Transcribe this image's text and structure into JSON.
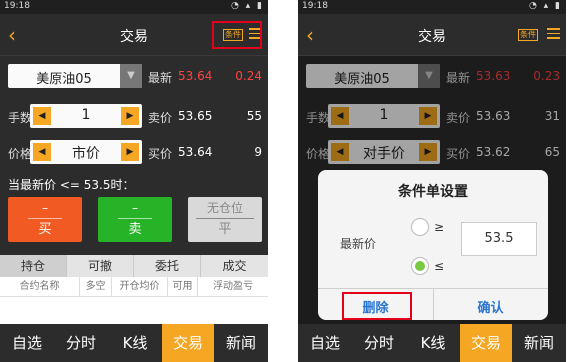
{
  "left": {
    "status_time": "19:18",
    "back_icon": "chevron-left-icon",
    "title": "交易",
    "condition_label": "条件",
    "menu_icon": "hamburger-menu-icon",
    "product": "美原油05",
    "latest_label": "最新",
    "latest_value": "53.64",
    "latest_change": "0.24",
    "qty_label": "手数",
    "qty_value": "1",
    "sell_label": "卖价",
    "sell_price": "53.65",
    "sell_volume": "55",
    "price_label": "价格",
    "price_type": "市价",
    "buy_label": "买价",
    "buy_price": "53.64",
    "buy_volume": "9",
    "condition_text": "当最新价 <= 53.5时：",
    "btn_buy_top": "–",
    "btn_buy_bottom": "买",
    "btn_sell_top": "–",
    "btn_sell_bottom": "卖",
    "btn_flat_top": "无仓位",
    "btn_flat_bottom": "平",
    "tabs": [
      "持仓",
      "可撤",
      "委托",
      "成交"
    ],
    "columns": [
      "合约名称",
      "多空",
      "开仓均价",
      "可用",
      "浮动盈亏"
    ]
  },
  "right": {
    "status_time": "19:18",
    "title": "交易",
    "condition_label": "条件",
    "product": "美原油05",
    "latest_label": "最新",
    "latest_value": "53.63",
    "latest_change": "0.23",
    "qty_label": "手数",
    "qty_value": "1",
    "sell_label": "卖价",
    "sell_price": "53.63",
    "sell_volume": "31",
    "price_label": "价格",
    "price_type": "对手价",
    "buy_label": "买价",
    "buy_price": "53.62",
    "buy_volume": "65",
    "dialog": {
      "title": "条件单设置",
      "field_label": "最新价",
      "option_ge": "≥",
      "option_le": "≤",
      "selected": "≤",
      "input_value": "53.5",
      "delete_label": "删除",
      "confirm_label": "确认"
    }
  },
  "bottom_nav": [
    "自选",
    "分时",
    "K线",
    "交易",
    "新闻"
  ],
  "active_nav": "交易",
  "colors": {
    "accent": "#f5a623",
    "price_up": "#ff4242",
    "buy": "#f15a22",
    "sell": "#27b327",
    "highlight_box": "#e3001b"
  }
}
